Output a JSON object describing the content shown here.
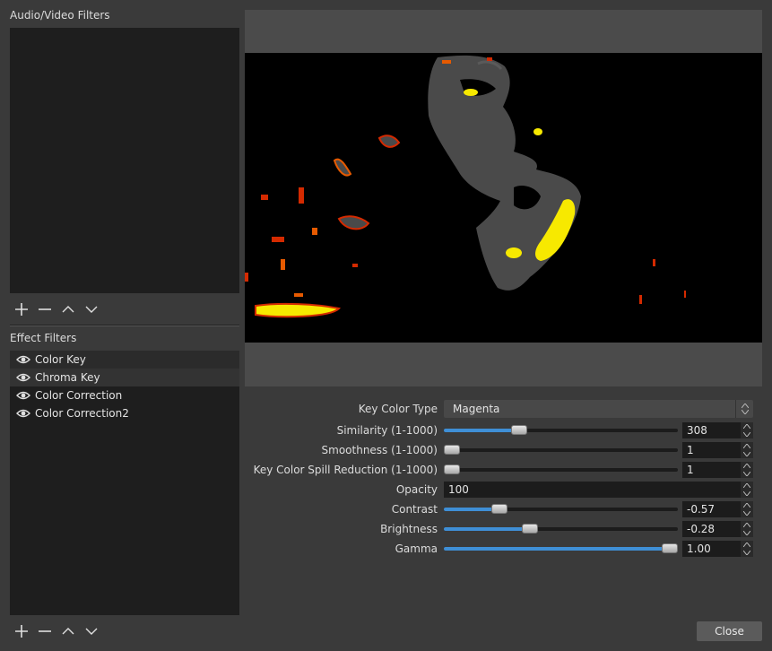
{
  "audio_video": {
    "title": "Audio/Video Filters"
  },
  "effect": {
    "title": "Effect Filters",
    "items": [
      {
        "label": "Color Key"
      },
      {
        "label": "Chroma Key"
      },
      {
        "label": "Color Correction"
      },
      {
        "label": "Color Correction2"
      }
    ]
  },
  "props": {
    "key_color_type": {
      "label": "Key Color Type",
      "value": "Magenta"
    },
    "similarity": {
      "label": "Similarity (1-1000)",
      "value": "308",
      "fraction": 0.31
    },
    "smoothness": {
      "label": "Smoothness (1-1000)",
      "value": "1",
      "fraction": 0.0
    },
    "spill": {
      "label": "Key Color Spill Reduction (1-1000)",
      "value": "1",
      "fraction": 0.0
    },
    "opacity": {
      "label": "Opacity",
      "value": "100"
    },
    "contrast": {
      "label": "Contrast",
      "value": "-0.57",
      "fraction": 0.22
    },
    "brightness": {
      "label": "Brightness",
      "value": "-0.28",
      "fraction": 0.36
    },
    "gamma": {
      "label": "Gamma",
      "value": "1.00",
      "fraction": 1.0
    }
  },
  "buttons": {
    "close": "Close"
  },
  "icons": {
    "add": "plus-icon",
    "remove": "minus-icon",
    "up": "chevron-up-icon",
    "down": "chevron-down-icon",
    "visibility": "eye-icon"
  },
  "colors": {
    "accent": "#3f8fd6",
    "panel": "#1e1e1e",
    "background": "#3a3a3a"
  }
}
